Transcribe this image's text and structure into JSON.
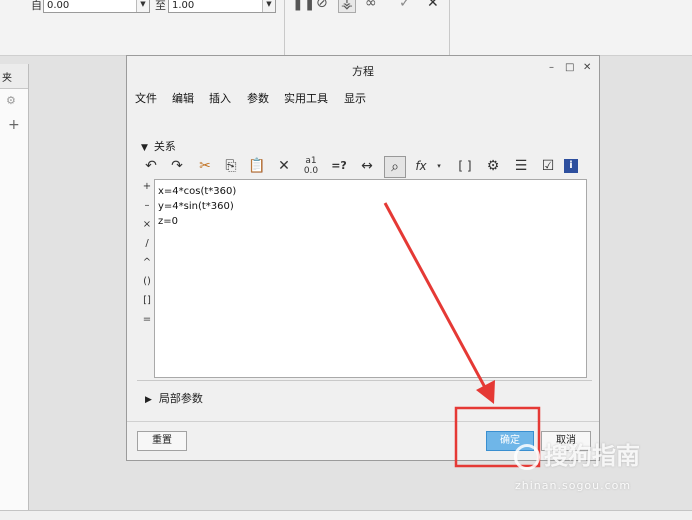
{
  "bg": {
    "label_from": "自",
    "field_from": "0.00",
    "label_to": "至",
    "field_to": "1.00",
    "left_tab": "夹"
  },
  "dialog": {
    "title": "方程",
    "menu": [
      "文件",
      "编辑",
      "插入",
      "参数",
      "实用工具",
      "显示"
    ],
    "section": "关系",
    "operators": [
      "+",
      "–",
      "×",
      "/",
      "^",
      "()",
      "[]",
      "="
    ],
    "lines": [
      "x=4*cos(t*360)",
      "y=4*sin(t*360)",
      "z=0"
    ],
    "local_params": "局部参数",
    "reset_label": "重置",
    "ok_label": "确定",
    "cancel_label": "取消"
  },
  "toolbar_icons": [
    "undo-icon",
    "redo-icon",
    "cut-icon",
    "copy-icon",
    "paste-icon",
    "delete-icon",
    "sort-icon",
    "evaluate-icon",
    "measure-icon",
    "verify-icon",
    "function-icon",
    "brackets-icon",
    "parameter-icon",
    "list-icon",
    "check-icon",
    "info-icon"
  ],
  "watermark": {
    "text": "搜狗指南",
    "url": "zhinan.sogou.com"
  },
  "colors": {
    "ok_button": "#6fb6e8",
    "annotation": "#e53935"
  }
}
